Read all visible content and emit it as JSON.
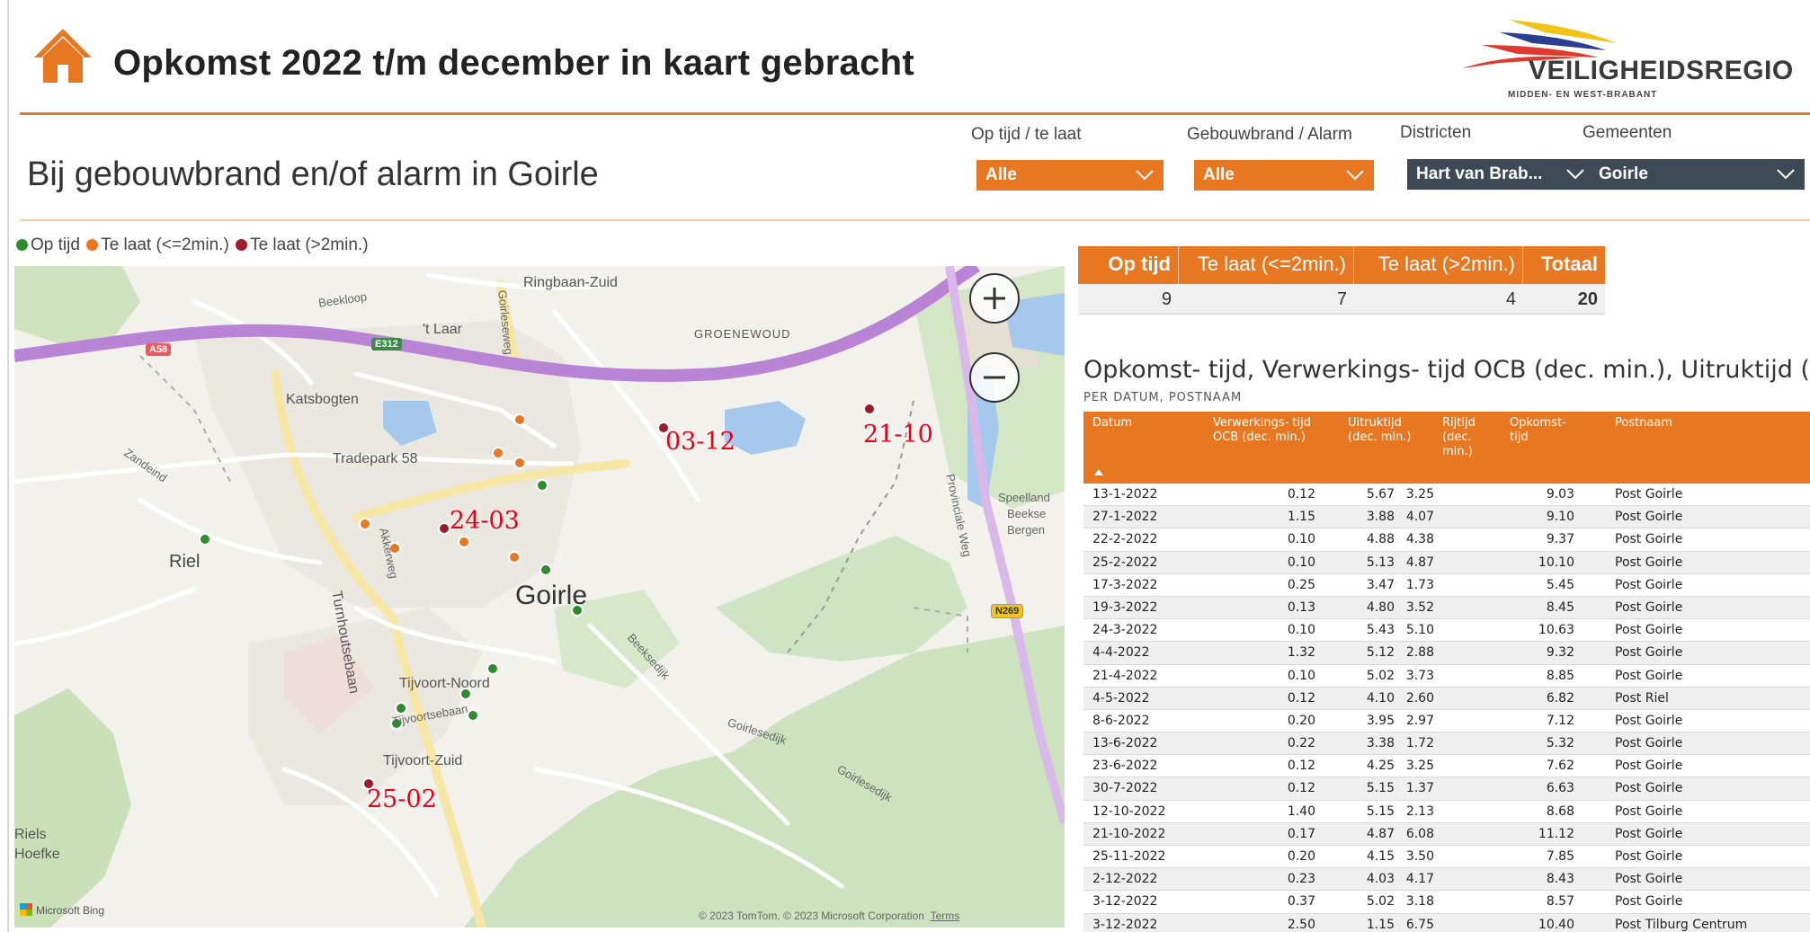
{
  "header": {
    "title": "Opkomst 2022 t/m december in kaart gebracht",
    "subtitle": "Bij gebouwbrand en/of alarm in Goirle",
    "logo_name": "VEILIGHEIDSREGIO",
    "logo_sub": "MIDDEN- EN WEST-BRABANT",
    "icon": "home-icon"
  },
  "colors": {
    "accent": "#e87722",
    "op_tijd": "#2e8b2e",
    "te_laat_kort": "#e87722",
    "te_laat_lang": "#9b1b2a",
    "slicer_dark": "#3d4a55",
    "date_label": "#e8001c"
  },
  "filters": [
    {
      "label": "Op tijd / te laat",
      "value": "Alle"
    },
    {
      "label": "Gebouwbrand / Alarm",
      "value": "Alle"
    },
    {
      "label": "Districten",
      "value": "Hart van Brab..."
    },
    {
      "label": "Gemeenten",
      "value": "Goirle"
    }
  ],
  "legend": {
    "items": [
      {
        "label": "Op tijd",
        "color": "#2e8b2e"
      },
      {
        "label": "Te laat (<=2min.)",
        "color": "#e87722"
      },
      {
        "label": "Te laat (>2min.)",
        "color": "#9b1b2a"
      }
    ]
  },
  "map": {
    "place_labels": {
      "ringbaan_zuid": "Ringbaan-Zuid",
      "beekloop": "Beekloop",
      "t_laar": "'t Laar",
      "groenewoud": "GROENEWOUD",
      "a58": "A58",
      "e312": "E312",
      "katsbogten": "Katsbogten",
      "tradepark": "Tradepark 58",
      "zandeind": "Zandeind",
      "riel": "Riel",
      "goirle": "Goirle",
      "turnhoutsebaan": "Turnhoutsebaan",
      "tijvoort_noord": "Tijvoort-Noord",
      "tijvoort_sebaan": "Tijvoortsebaan",
      "tijvoort_zuid": "Tijvoort-Zuid",
      "riels": "Riels",
      "hoefke": "Hoefke",
      "speelland": "Speelland",
      "beekse": "Beekse",
      "bergen": "Bergen",
      "provinciale_weg": "Provinciale Weg",
      "n269": "N269",
      "beeksedijk": "Beeksedijk",
      "goirlesedijk_1": "Goirlesedijk",
      "goirlesedijk_2": "Goirlesedijk",
      "goirleseweg": "Goirleseweg",
      "akkerweg": "Akkerweg"
    },
    "date_labels": {
      "a": "03-12",
      "b": "21-10",
      "c": "24-03",
      "d": "25-02"
    },
    "zoom_in": "zoom-in-icon",
    "zoom_out": "zoom-out-icon",
    "bing": "Microsoft Bing",
    "attribution": "© 2023 TomTom, © 2023 Microsoft Corporation",
    "terms": "Terms"
  },
  "summary": {
    "headers": [
      "Op tijd",
      "Te laat (<=2min.)",
      "Te laat (>2min.)",
      "Totaal"
    ],
    "values": [
      "9",
      "7",
      "4",
      "20"
    ]
  },
  "detail": {
    "title": "Opkomst- tijd, Verwerkings- tijd OCB (dec. min.), Uitruktijd (dec...",
    "subtitle": "PER DATUM, POSTNAAM",
    "headers": {
      "datum": "Datum",
      "verwerking": "Verwerkings- tijd OCB (dec. min.)",
      "uitruk": "Uitruktijd (dec. min.)",
      "rijtijd": "Rijtijd (dec. min.)",
      "opkomst": "Opkomst- tijd",
      "postnaam": "Postnaam"
    },
    "rows": [
      [
        "13-1-2022",
        "0.12",
        "5.67",
        "3.25",
        "9.03",
        "Post Goirle"
      ],
      [
        "27-1-2022",
        "1.15",
        "3.88",
        "4.07",
        "9.10",
        "Post Goirle"
      ],
      [
        "22-2-2022",
        "0.10",
        "4.88",
        "4.38",
        "9.37",
        "Post Goirle"
      ],
      [
        "25-2-2022",
        "0.10",
        "5.13",
        "4.87",
        "10.10",
        "Post Goirle"
      ],
      [
        "17-3-2022",
        "0.25",
        "3.47",
        "1.73",
        "5.45",
        "Post Goirle"
      ],
      [
        "19-3-2022",
        "0.13",
        "4.80",
        "3.52",
        "8.45",
        "Post Goirle"
      ],
      [
        "24-3-2022",
        "0.10",
        "5.43",
        "5.10",
        "10.63",
        "Post Goirle"
      ],
      [
        "4-4-2022",
        "1.32",
        "5.12",
        "2.88",
        "9.32",
        "Post Goirle"
      ],
      [
        "21-4-2022",
        "0.10",
        "5.02",
        "3.73",
        "8.85",
        "Post Goirle"
      ],
      [
        "4-5-2022",
        "0.12",
        "4.10",
        "2.60",
        "6.82",
        "Post Riel"
      ],
      [
        "8-6-2022",
        "0.20",
        "3.95",
        "2.97",
        "7.12",
        "Post Goirle"
      ],
      [
        "13-6-2022",
        "0.22",
        "3.38",
        "1.72",
        "5.32",
        "Post Goirle"
      ],
      [
        "23-6-2022",
        "0.12",
        "4.25",
        "3.25",
        "7.62",
        "Post Goirle"
      ],
      [
        "30-7-2022",
        "0.12",
        "5.15",
        "1.37",
        "6.63",
        "Post Goirle"
      ],
      [
        "12-10-2022",
        "1.40",
        "5.15",
        "2.13",
        "8.68",
        "Post Goirle"
      ],
      [
        "21-10-2022",
        "0.17",
        "4.87",
        "6.08",
        "11.12",
        "Post Goirle"
      ],
      [
        "25-11-2022",
        "0.20",
        "4.15",
        "3.50",
        "7.85",
        "Post Goirle"
      ],
      [
        "2-12-2022",
        "0.23",
        "4.03",
        "4.17",
        "8.43",
        "Post Goirle"
      ],
      [
        "3-12-2022",
        "0.37",
        "5.02",
        "3.18",
        "8.57",
        "Post Goirle"
      ],
      [
        "3-12-2022",
        "2.50",
        "1.15",
        "6.75",
        "10.40",
        "Post Tilburg Centrum"
      ]
    ]
  }
}
